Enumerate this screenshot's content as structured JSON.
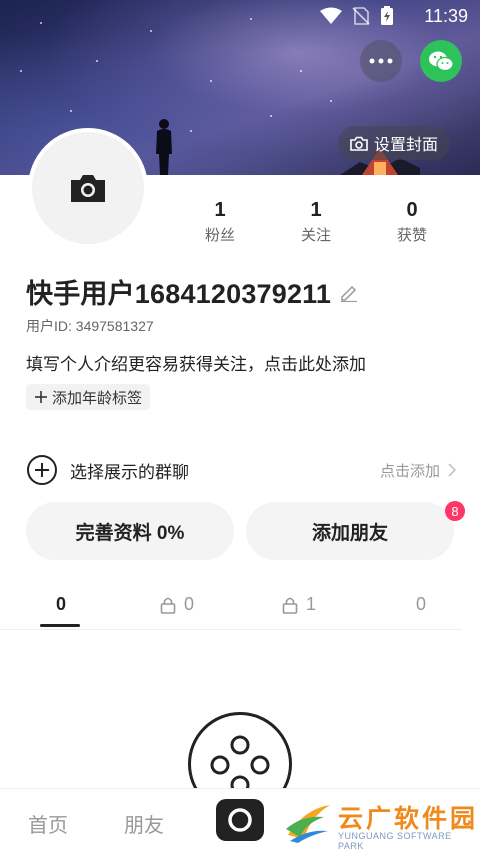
{
  "status_bar": {
    "time": "11:39"
  },
  "header": {
    "set_cover_label": "设置封面"
  },
  "stats": [
    {
      "value": "1",
      "label": "粉丝"
    },
    {
      "value": "1",
      "label": "关注"
    },
    {
      "value": "0",
      "label": "获赞"
    }
  ],
  "profile": {
    "username": "快手用户1684120379211",
    "user_id": "用户ID: 3497581327",
    "bio_prompt": "填写个人介绍更容易获得关注，点击此处添加",
    "age_tag_label": "添加年龄标签"
  },
  "group_chat": {
    "label": "选择展示的群聊",
    "action": "点击添加"
  },
  "actions": {
    "complete_profile_label": "完善资料 0%",
    "add_friends_label": "添加朋友",
    "add_friends_badge": "8"
  },
  "tabs": [
    {
      "count": "0",
      "locked": false
    },
    {
      "count": "0",
      "locked": true
    },
    {
      "count": "1",
      "locked": true
    },
    {
      "count": "0",
      "locked": false
    }
  ],
  "bottom_nav": {
    "home_label": "首页",
    "friends_label": "朋友"
  },
  "watermark": {
    "title": "云广软件园",
    "subtitle": "YUNGUANG SOFTWARE PARK"
  },
  "colors": {
    "accent_green": "#2ec25a",
    "badge_red": "#fe3666",
    "watermark_orange": "#f08a1c"
  }
}
